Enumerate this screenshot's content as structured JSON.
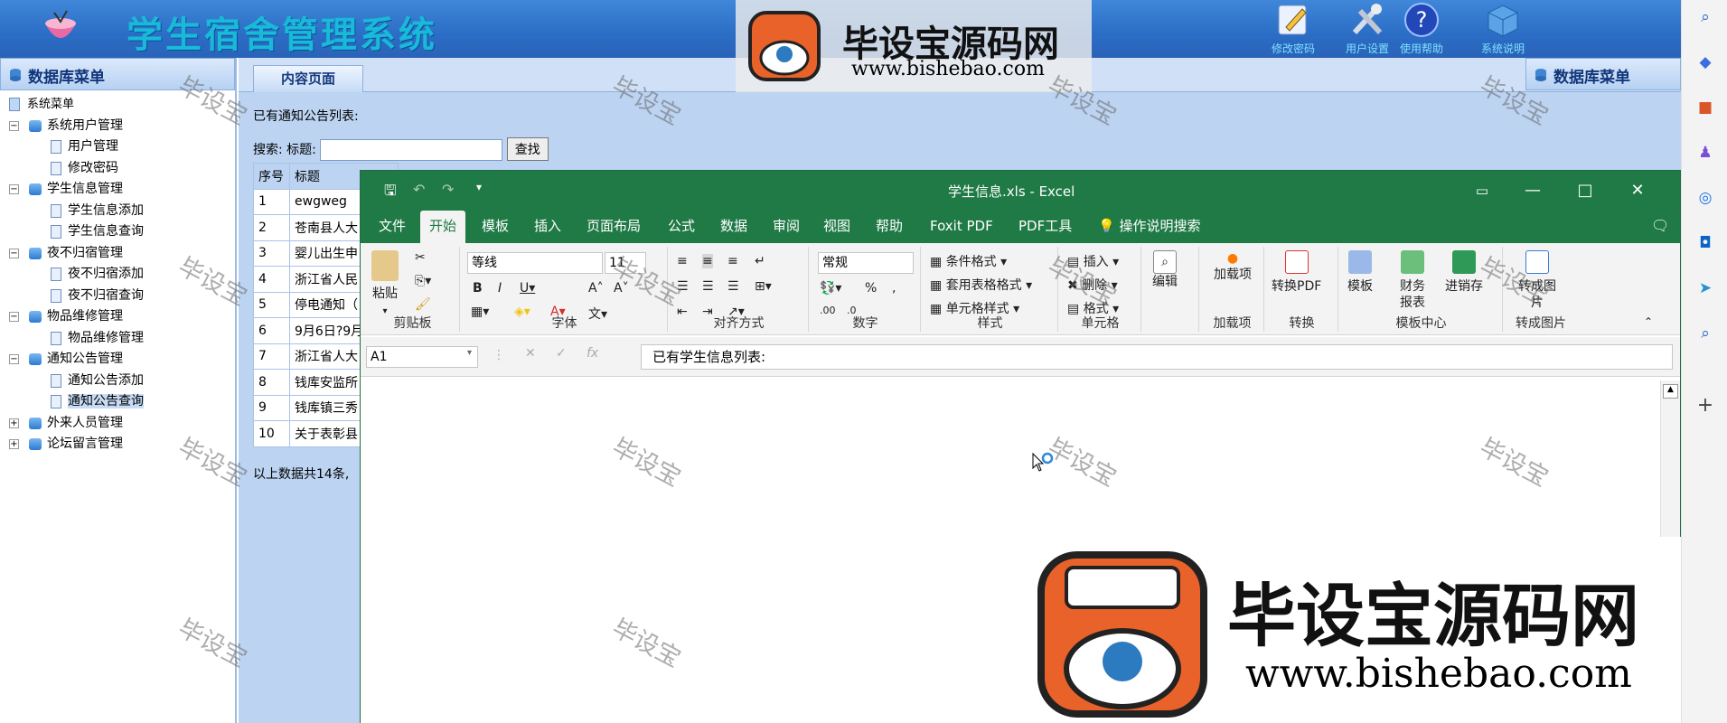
{
  "header": {
    "title": "学生宿舍管理系统",
    "buttons": [
      "修改密码",
      "用户设置",
      "使用帮助",
      "系统说明"
    ]
  },
  "sidebar": {
    "head": "数据库菜单",
    "root": "系统菜单",
    "groups": [
      {
        "label": "系统用户管理",
        "items": [
          "用户管理",
          "修改密码"
        ]
      },
      {
        "label": "学生信息管理",
        "items": [
          "学生信息添加",
          "学生信息查询"
        ]
      },
      {
        "label": "夜不归宿管理",
        "items": [
          "夜不归宿添加",
          "夜不归宿查询"
        ]
      },
      {
        "label": "物品维修管理",
        "items": [
          "物品维修管理"
        ]
      },
      {
        "label": "通知公告管理",
        "items": [
          "通知公告添加",
          "通知公告查询"
        ]
      },
      {
        "label": "外来人员管理",
        "items": []
      },
      {
        "label": "论坛留言管理",
        "items": []
      }
    ]
  },
  "main": {
    "tab": "内容页面",
    "right_head": "数据库菜单",
    "list_title": "已有通知公告列表:",
    "search_label": "搜索: 标题:",
    "search_value": "",
    "search_button": "查找",
    "columns": [
      "序号",
      "标题"
    ],
    "rows": [
      [
        "1",
        "ewgweg"
      ],
      [
        "2",
        "苍南县人大"
      ],
      [
        "3",
        "婴儿出生申"
      ],
      [
        "4",
        "浙江省人民"
      ],
      [
        "5",
        "停电通知（"
      ],
      [
        "6",
        "9月6日?9月"
      ],
      [
        "7",
        "浙江省人大"
      ],
      [
        "8",
        "钱库安监所"
      ],
      [
        "9",
        "钱库镇三秀"
      ],
      [
        "10",
        "关于表彰县"
      ]
    ],
    "footer": "以上数据共14条,"
  },
  "excel": {
    "title": "学生信息.xls  -  Excel",
    "menu": [
      "文件",
      "开始",
      "模板",
      "插入",
      "页面布局",
      "公式",
      "数据",
      "审阅",
      "视图",
      "帮助",
      "Foxit PDF",
      "PDF工具",
      "操作说明搜索"
    ],
    "active_menu": "开始",
    "ribbon": {
      "clipboard": {
        "label": "剪贴板",
        "paste": "粘贴"
      },
      "font": {
        "label": "字体",
        "name": "等线",
        "size": "11"
      },
      "align": {
        "label": "对齐方式"
      },
      "number": {
        "label": "数字",
        "format": "常规"
      },
      "styles": {
        "label": "样式",
        "items": [
          "条件格式",
          "套用表格格式",
          "单元格样式"
        ]
      },
      "cells": {
        "label": "单元格",
        "items": [
          "插入",
          "删除",
          "格式"
        ]
      },
      "editing": {
        "label": "编辑"
      },
      "addins": {
        "label": "加载项",
        "btn": "加载项"
      },
      "convert": {
        "label": "转换",
        "btn": "转换PDF"
      },
      "templates": {
        "label": "模板中心",
        "items": [
          "模板",
          "财务报表",
          "进销存"
        ]
      },
      "topic": {
        "label": "转成图片",
        "btn": "转成图片"
      }
    },
    "namebox": "A1",
    "formula": "已有学生信息列表:"
  },
  "watermark": {
    "text": "毕设宝",
    "brand": "毕设宝源码网",
    "url": "www.bishebao.com"
  },
  "colors": {
    "excel_green": "#1f7a45",
    "header_blue": "#2b6dc6",
    "content_bg": "#bcd4f2"
  }
}
